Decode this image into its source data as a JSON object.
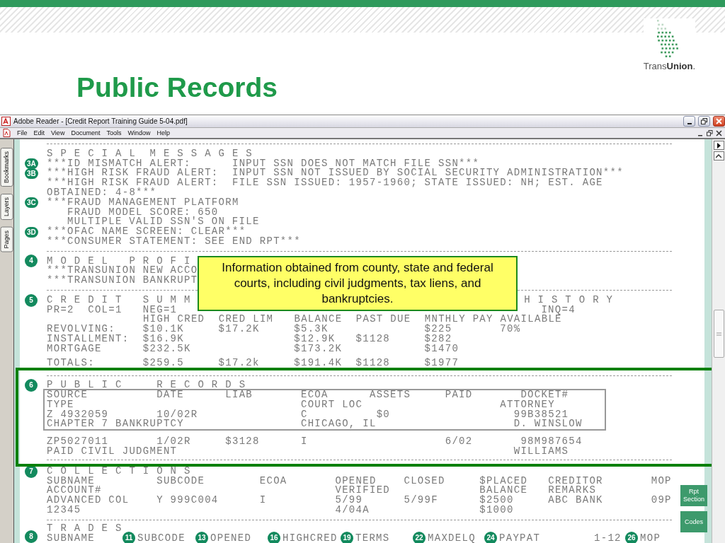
{
  "slide": {
    "title": "Public Records",
    "logo": {
      "text": "Trans**Union**."
    }
  },
  "window": {
    "title": "Adobe Reader - [Credit Report Training Guide 5-04.pdf]",
    "menu": [
      "File",
      "Edit",
      "View",
      "Document",
      "Tools",
      "Window",
      "Help"
    ],
    "side_tabs": [
      "Bookmarks",
      "Layers",
      "Pages"
    ]
  },
  "report": {
    "lines": [
      {
        "kind": "rule"
      },
      {
        "kind": "heading",
        "text": "S P E C I A L  M E S S A G E S"
      },
      {
        "kind": "text",
        "badge": "3A",
        "text": "***ID MISMATCH ALERT:      INPUT SSN DOES NOT MATCH FILE SSN***"
      },
      {
        "kind": "text",
        "badge": "3B",
        "text": "***HIGH RISK FRAUD ALERT:  INPUT SSN NOT ISSUED BY SOCIAL SECURITY ADMINISTRATION***"
      },
      {
        "kind": "text",
        "text": "***HIGH RISK FRAUD ALERT:  FILE SSN ISSUED: 1957-1960; STATE ISSUED: NH; EST. AGE"
      },
      {
        "kind": "text",
        "text": "OBTAINED: 4-8***"
      },
      {
        "kind": "text",
        "badge": "3C",
        "text": "***FRAUD MANAGEMENT PLATFORM"
      },
      {
        "kind": "sub",
        "text": "FRAUD MODEL SCORE: 650"
      },
      {
        "kind": "sub",
        "text": "MULTIPLE VALID SSN'S ON FILE"
      },
      {
        "kind": "text",
        "badge": "3D",
        "text": "***OFAC NAME SCREEN: CLEAR***"
      },
      {
        "kind": "text",
        "text": "***CONSUMER STATEMENT: SEE END RPT***"
      },
      {
        "kind": "rule"
      },
      {
        "kind": "heading",
        "badge": "4",
        "text": "M O D E L   P R O F I"
      },
      {
        "kind": "text",
        "text": "***TRANSUNION NEW ACCO"
      },
      {
        "kind": "text",
        "text": "***TRANSUNION BANKRUPT"
      },
      {
        "kind": "rule"
      },
      {
        "kind": "split",
        "badge": "5",
        "text": "C R E D I T   S U M M",
        "right": "H I S T O R Y"
      },
      {
        "kind": "split",
        "text": "PR=2  COL=1   NEG=1",
        "right": "INQ=4"
      },
      {
        "kind": "cols",
        "text": "HIGH CRED  CRED LIM   BALANCE  PAST DUE  MNTHLY PAY AVAILABLE"
      },
      {
        "kind": "text",
        "text": "REVOLVING:    $10.1K     $17.2K     $5.3K              $225       70%"
      },
      {
        "kind": "text",
        "text": "INSTALLMENT:  $16.9K                $12.9K   $1128     $282"
      },
      {
        "kind": "text",
        "text": "MORTGAGE      $232.5K               $173.2K            $1470"
      },
      {
        "kind": "total",
        "text": "TOTALS:       $259.5     $17.2k     $191.4K  $1128     $1977"
      },
      {
        "kind": "highlight",
        "lines": [
          {
            "kind": "rule"
          },
          {
            "kind": "heading",
            "badge": "6",
            "text": "P U B L I C     R E C O R D S"
          },
          {
            "kind": "box",
            "lines": [
              {
                "kind": "text",
                "text": "SOURCE          DATE      LIAB       ECOA      ASSETS     PAID       DOCKET#"
              },
              {
                "kind": "text",
                "text": "TYPE                                 COURT LOC                    ATTORNEY"
              },
              {
                "kind": "text",
                "text": "Z 4932059       10/02R               C          $0                  99B38521"
              },
              {
                "kind": "text",
                "text": "CHAPTER 7 BANKRUPTCY                 CHICAGO, IL                    D. WINSLOW"
              }
            ]
          },
          {
            "kind": "blank"
          },
          {
            "kind": "text",
            "text": "ZP5027011       1/02R     $3128      I                    6/02       98M987654"
          },
          {
            "kind": "text",
            "text": "PAID CIVIL JUDGMENT                                                 WILLIAMS"
          },
          {
            "kind": "rule"
          }
        ]
      },
      {
        "kind": "heading",
        "badge": "7",
        "text": "C O L L E C T I O N S"
      },
      {
        "kind": "text",
        "text": "SUBNAME         SUBCODE        ECOA       OPENED    CLOSED     $PLACED   CREDITOR       MOP"
      },
      {
        "kind": "text",
        "text": "ACCOUNT#                                  VERIFIED             BALANCE   REMARKS"
      },
      {
        "kind": "text",
        "text": "ADVANCED COL    Y 999C004      I          5/99      5/99F      $2500     ABC BANK       09P"
      },
      {
        "kind": "text",
        "text": "12345                                     4/04A                $1000"
      },
      {
        "kind": "rule"
      },
      {
        "kind": "heading",
        "text": "T R A D E S"
      },
      {
        "kind": "fields",
        "badge": "8",
        "cells": [
          {
            "text": "SUBNAME"
          },
          {
            "badge": "11",
            "text": "SUBCODE"
          },
          {
            "badge": "13",
            "text": "OPENED"
          },
          {
            "badge": "16",
            "text": "HIGHCRED"
          },
          {
            "badge": "19",
            "text": "TERMS"
          },
          {
            "badge": "22",
            "text": "MAXDELQ"
          },
          {
            "badge": "24",
            "text": "PAYPAT"
          },
          {
            "text": "1-12"
          },
          {
            "badge": "26",
            "text": "MOP"
          }
        ]
      }
    ]
  },
  "callout": {
    "text": "Information obtained from county, state and federal courts, including civil judgments, tax liens, and bankruptcies."
  },
  "side_buttons": [
    "Rpt Section",
    "Codes"
  ]
}
